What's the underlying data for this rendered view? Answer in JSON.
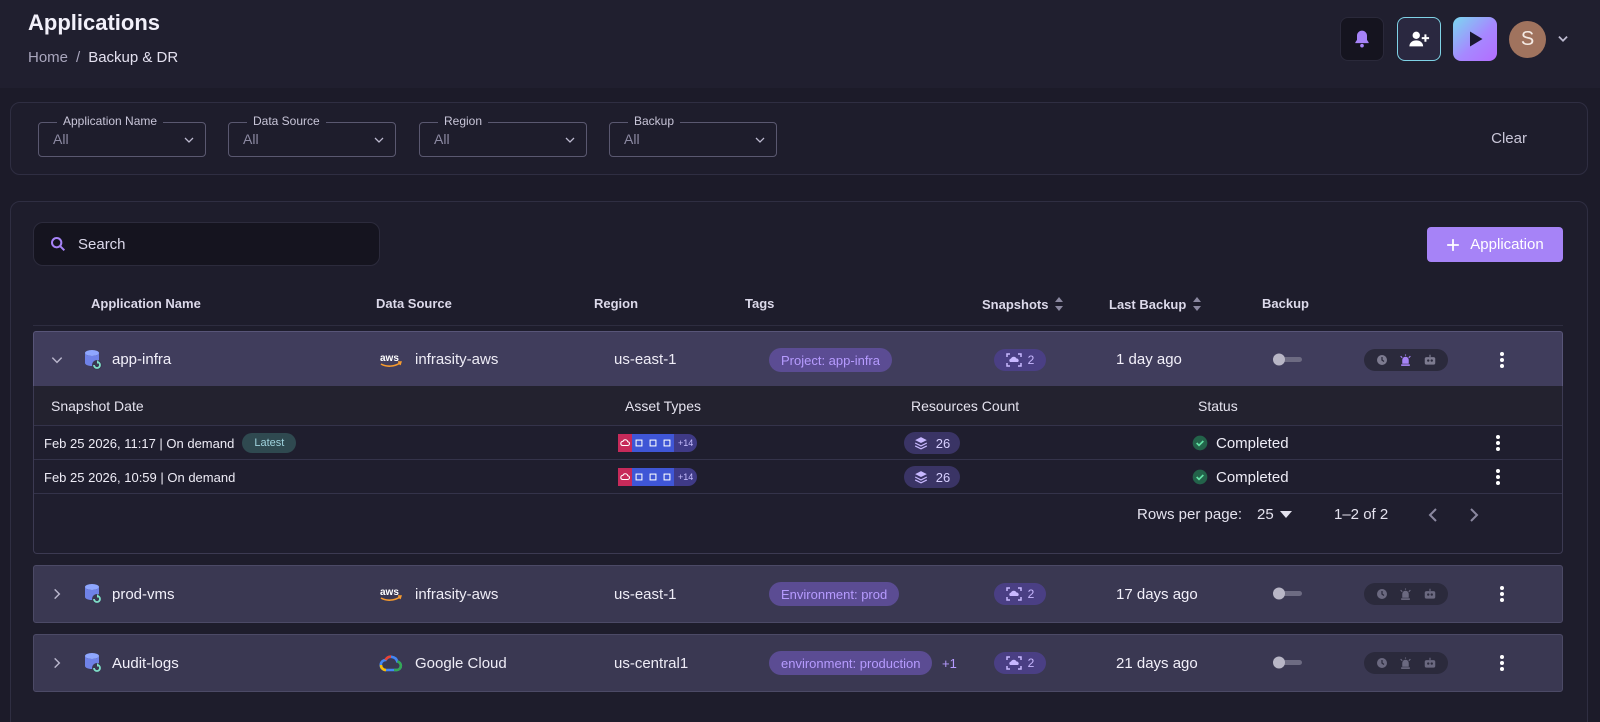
{
  "header": {
    "title": "Applications",
    "breadcrumb": {
      "home": "Home",
      "separator": "/",
      "current": "Backup & DR"
    },
    "avatar_initial": "S"
  },
  "filters": {
    "items": [
      {
        "label": "Application Name",
        "value": "All"
      },
      {
        "label": "Data Source",
        "value": "All"
      },
      {
        "label": "Region",
        "value": "All"
      },
      {
        "label": "Backup",
        "value": "All"
      }
    ],
    "clear_label": "Clear"
  },
  "search": {
    "placeholder": "Search"
  },
  "add_button": {
    "label": "Application"
  },
  "columns": {
    "name": "Application Name",
    "data_source": "Data Source",
    "region": "Region",
    "tags": "Tags",
    "snapshots": "Snapshots",
    "last_backup": "Last Backup",
    "backup": "Backup"
  },
  "apps": [
    {
      "name": "app-infra",
      "data_source": "infrasity-aws",
      "data_source_icon": "aws-icon",
      "region": "us-east-1",
      "tag": "Project: app-infra",
      "tag_more": "",
      "snapshots": "2",
      "last_backup": "1 day ago",
      "backup_enabled": false,
      "expanded": true
    },
    {
      "name": "prod-vms",
      "data_source": "infrasity-aws",
      "data_source_icon": "aws-icon",
      "region": "us-east-1",
      "tag": "Environment: prod",
      "tag_more": "",
      "snapshots": "2",
      "last_backup": "17 days ago",
      "backup_enabled": false,
      "expanded": false
    },
    {
      "name": "Audit-logs",
      "data_source": "Google Cloud",
      "data_source_icon": "google-cloud-icon",
      "region": "us-central1",
      "tag": "environment: production",
      "tag_more": "+1",
      "snapshots": "2",
      "last_backup": "21 days ago",
      "backup_enabled": false,
      "expanded": false
    }
  ],
  "snapshot_table": {
    "columns": {
      "date": "Snapshot Date",
      "asset_types": "Asset Types",
      "resources": "Resources Count",
      "status": "Status"
    },
    "rows": [
      {
        "date": "Feb 25 2026, 11:17 | On demand",
        "badge": "Latest",
        "assets_more": "+14",
        "resources": "26",
        "status": "Completed"
      },
      {
        "date": "Feb 25 2026, 10:59 | On demand",
        "badge": "",
        "assets_more": "+14",
        "resources": "26",
        "status": "Completed"
      }
    ],
    "pagination": {
      "rows_label": "Rows per page:",
      "rows_value": "25",
      "range": "1–2 of 2"
    }
  },
  "colors": {
    "accent": "#a683f7",
    "background": "#1c1b29",
    "row_background": "#3a3852",
    "tag_text": "#b69bff",
    "success": "#2f9e6a",
    "latest_badge": "#2f4950"
  }
}
